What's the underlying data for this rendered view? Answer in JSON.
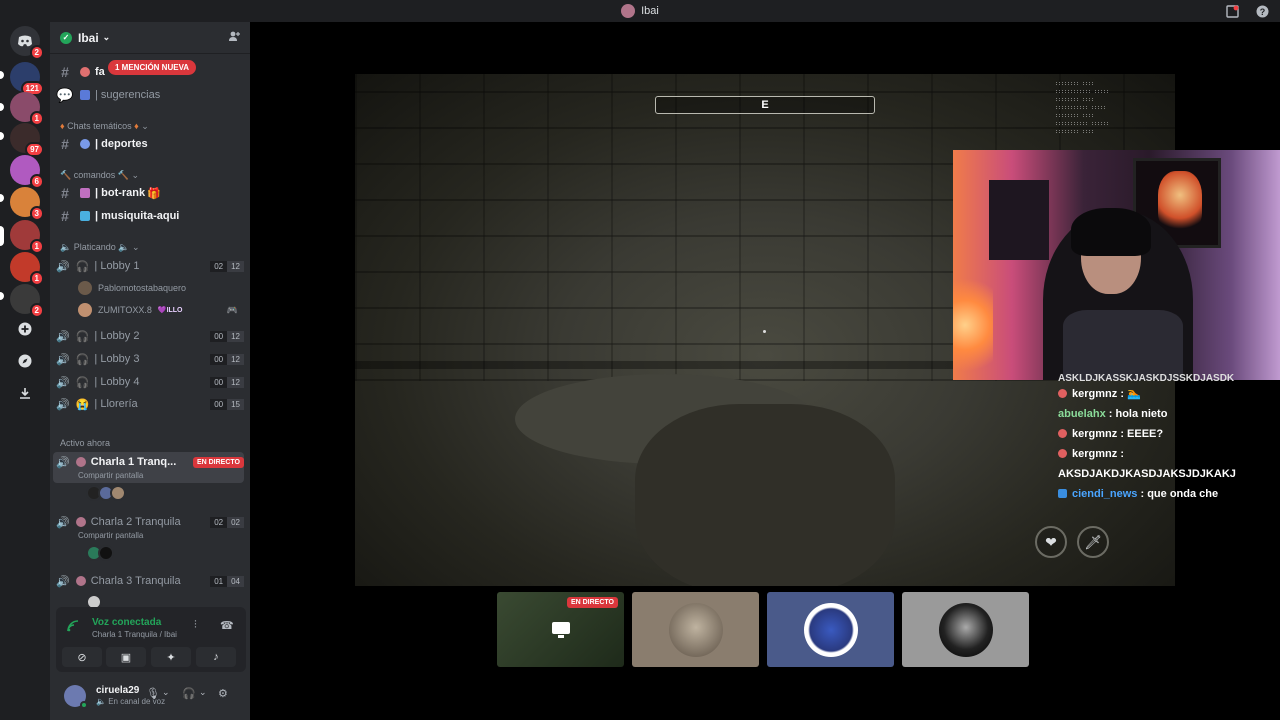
{
  "titlebar": {
    "title": "Ibai"
  },
  "rail": {
    "badges": [
      "2",
      "121",
      "1",
      "97",
      "6",
      "3",
      "1",
      "1",
      "2"
    ]
  },
  "server": {
    "name": "Ibai"
  },
  "channels": {
    "mention": "1 MENCIÓN NUEVA",
    "fa": "fa",
    "sugerencias": "| sugerencias",
    "cat_chats": "Chats temáticos",
    "deportes": "| deportes",
    "cat_comandos": "comandos",
    "botrank": "| bot-rank",
    "musiquita": "| musiquita-aqui",
    "cat_platicando": "Platicando",
    "lobby1": "| Lobby 1",
    "lobby1_counts": [
      "02",
      "12"
    ],
    "lobby1_users": [
      "Pablomotostabaquero",
      "ZUMITOXX.8"
    ],
    "illo_tag": "ILLO",
    "lobby2": "| Lobby 2",
    "lobby2_counts": [
      "00",
      "12"
    ],
    "lobby3": "| Lobby 3",
    "lobby3_counts": [
      "00",
      "12"
    ],
    "lobby4": "| Lobby 4",
    "lobby4_counts": [
      "00",
      "12"
    ],
    "lloreria": "| Llorería",
    "lloreria_counts": [
      "00",
      "15"
    ],
    "cat_activo": "Activo ahora",
    "charla1": "Charla 1 Tranq...",
    "charla1_live": "EN DIRECTO",
    "charla1_sub": "Compartir pantalla",
    "charla2": "Charla 2 Tranquila",
    "charla2_counts": [
      "02",
      "02"
    ],
    "charla2_sub": "Compartir pantalla",
    "charla3": "Charla 3 Tranquila",
    "charla3_counts": [
      "01",
      "04"
    ]
  },
  "voice": {
    "status": "Voz conectada",
    "channel": "Charla 1 Tranquila / Ibai"
  },
  "user": {
    "name": "ciruela29",
    "status": "En canal de voz"
  },
  "game": {
    "compass": "E",
    "stats": ":::::::: ::::\n:::::::::::: :::::\n:::::::: ::::\n::::::::::: :::::\n:::::::: ::::\n::::::::::: ::::::\n:::::::: ::::"
  },
  "chat": {
    "scrolled": "ASKLDJKASSKJASKDJSSKDJASDK",
    "messages": [
      {
        "user": "kergmnz",
        "text": ": 🏊"
      },
      {
        "user": "abuelahx",
        "text": ": hola nieto"
      },
      {
        "user": "kergmnz",
        "text": ": EEEE?"
      },
      {
        "user": "kergmnz",
        "text": ":"
      },
      {
        "user": "",
        "text": "AKSDJAKDJKASDJAKSJDJKAKJ"
      },
      {
        "user": "ciendi_news",
        "text": ": que onda che"
      }
    ]
  },
  "tiles": {
    "live": "EN DIRECTO"
  },
  "colors": {
    "accent": "#23a55a",
    "danger": "#da373c",
    "rail": "#1e1f22",
    "sidebar": "#2b2d31"
  }
}
